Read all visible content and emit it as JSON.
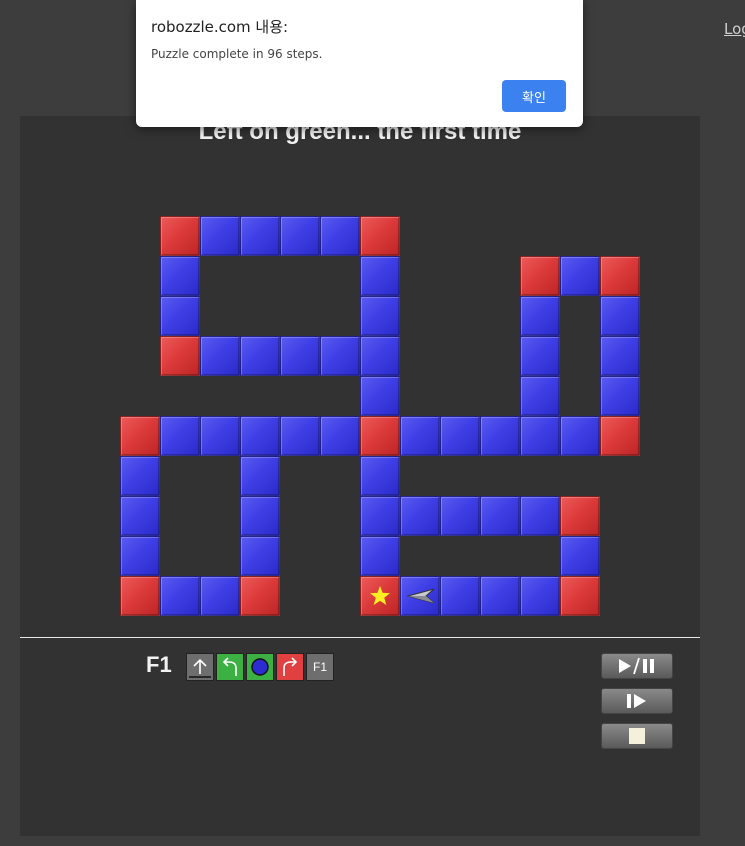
{
  "header": {
    "login_link": "Log"
  },
  "alert": {
    "origin": "robozzle.com 내용:",
    "message": "Puzzle complete in 96 steps.",
    "ok_label": "확인"
  },
  "puzzle": {
    "title": "Left on green... the first time",
    "board": {
      "colors": {
        "blue": "#3f3fe6",
        "red": "#dd3b3b",
        "star": "#ffee22"
      },
      "rows": [
        "...............",
        "...............",
        "...RBBBBR......",
        "...B....B...RBR",
        "...B....B...B.B",
        "...RBBBBB...B.B",
        "........B...B.B",
        "..RBBBBBRBBBBBR",
        "..B..B..B......",
        "..B..B..BBBBBR.",
        "..B..B..B....B.",
        "..RBBR..RBBBBR."
      ],
      "star": {
        "row": 11,
        "col": 8
      },
      "robot": {
        "row": 11,
        "col": 9,
        "direction": "left"
      }
    }
  },
  "program": {
    "function_label": "F1",
    "slots": [
      {
        "name": "forward",
        "color": "grey",
        "icon": "forward-arrow-icon"
      },
      {
        "name": "turn-left",
        "color": "green",
        "icon": "turn-left-icon"
      },
      {
        "name": "paint-blue",
        "color": "green",
        "icon": "paint-blue-icon"
      },
      {
        "name": "turn-right",
        "color": "red",
        "icon": "turn-right-icon"
      },
      {
        "name": "call-f1",
        "color": "grey",
        "label": "F1"
      }
    ]
  },
  "controls": [
    {
      "name": "play-pause",
      "icon": "play-pause-icon"
    },
    {
      "name": "step",
      "icon": "step-icon"
    },
    {
      "name": "stop",
      "icon": "stop-icon"
    }
  ]
}
